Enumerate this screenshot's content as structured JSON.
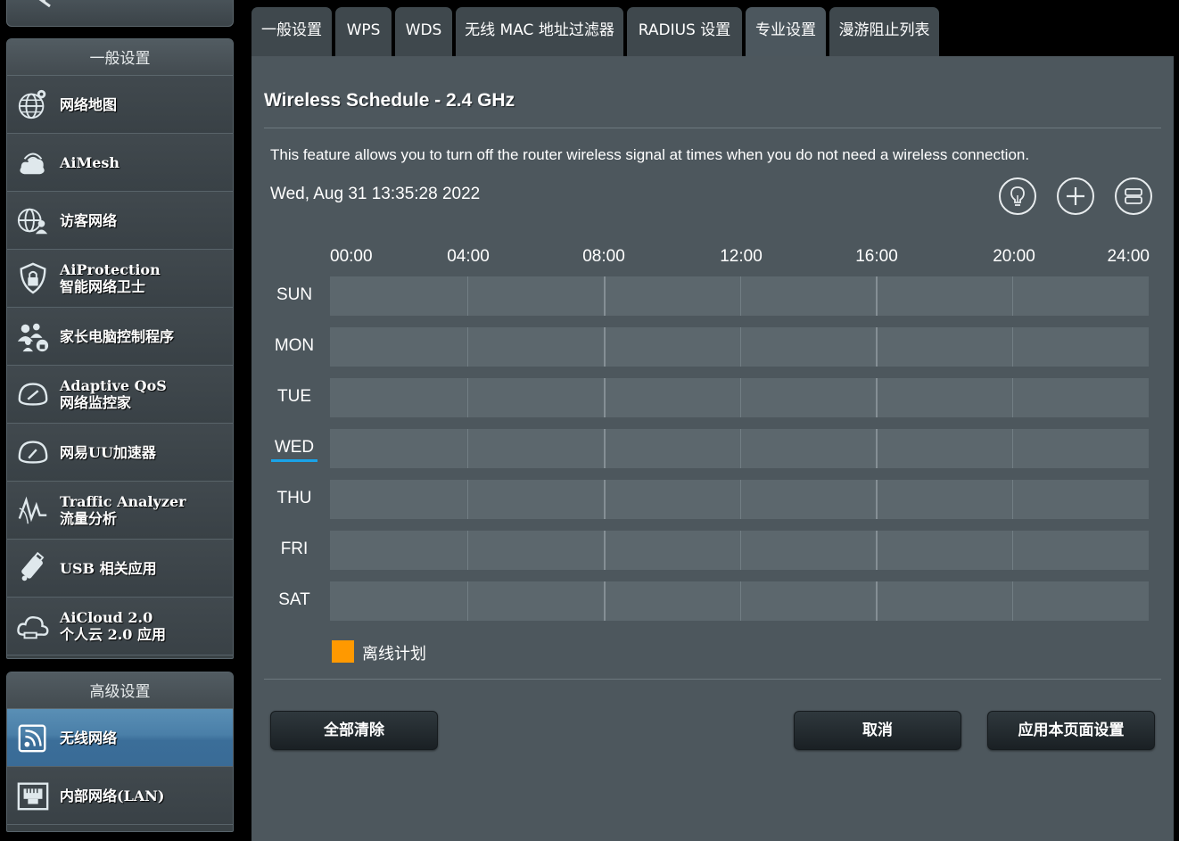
{
  "colors": {
    "panel": "#4d575d",
    "row": "#5c676d",
    "accent": "#1aa3e8",
    "offline": "#ff9900",
    "active_nav": "#4a7fa8"
  },
  "sidebar": {
    "group1": {
      "header": "一般设置",
      "items": [
        {
          "label": "网络地图",
          "icon": "globe-network-icon"
        },
        {
          "label": "AiMesh",
          "icon": "mesh-icon"
        },
        {
          "label": "访客网络",
          "icon": "guest-network-icon"
        },
        {
          "label": "AiProtection",
          "sub": "智能网络卫士",
          "icon": "shield-lock-icon"
        },
        {
          "label": "家长电脑控制程序",
          "icon": "parental-control-icon"
        },
        {
          "label": "Adaptive QoS",
          "sub": "网络监控家",
          "icon": "gauge-icon"
        },
        {
          "label": "网易UU加速器",
          "icon": "speedometer-icon"
        },
        {
          "label": "Traffic Analyzer",
          "sub": "流量分析",
          "icon": "traffic-wave-icon"
        },
        {
          "label": "USB 相关应用",
          "icon": "usb-icon"
        },
        {
          "label": "AiCloud 2.0",
          "sub": "个人云 2.0 应用",
          "icon": "cloud-icon"
        }
      ]
    },
    "group2": {
      "header": "高级设置",
      "items": [
        {
          "label": "无线网络",
          "icon": "wireless-icon",
          "active": true
        },
        {
          "label": "内部网络(LAN)",
          "icon": "lan-port-icon"
        }
      ]
    }
  },
  "tabs": [
    {
      "label": "一般设置"
    },
    {
      "label": "WPS"
    },
    {
      "label": "WDS"
    },
    {
      "label": "无线 MAC 地址过滤器"
    },
    {
      "label": "RADIUS 设置"
    },
    {
      "label": "专业设置",
      "active": true
    },
    {
      "label": "漫游阻止列表"
    }
  ],
  "schedule": {
    "title": "Wireless Schedule - 2.4 GHz",
    "description": "This feature allows you to turn off the router wireless signal at times when you do not need a wireless connection.",
    "datetime": "Wed, Aug 31 13:35:28 2022",
    "time_labels": [
      "00:00",
      "04:00",
      "08:00",
      "12:00",
      "16:00",
      "20:00",
      "24:00"
    ],
    "days": [
      "SUN",
      "MON",
      "TUE",
      "WED",
      "THU",
      "FRI",
      "SAT"
    ],
    "current_day": "WED",
    "legend": "离线计划"
  },
  "buttons": {
    "clear_all": "全部清除",
    "cancel": "取消",
    "apply": "应用本页面设置"
  }
}
